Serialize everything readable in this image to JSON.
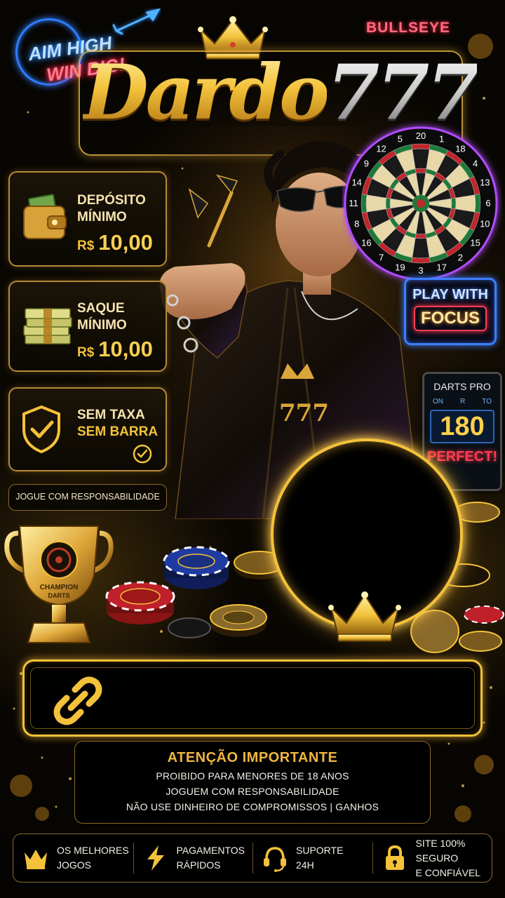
{
  "header": {
    "neon_line1": "AIM HIGH",
    "neon_line2": "WIN BIG!",
    "bullseye_label": "BULLSEYE",
    "logo_word": "Dardo",
    "logo_number": "777"
  },
  "cards": {
    "deposit": {
      "label_line1": "DEPÓSITO",
      "label_line2": "MÍNIMO",
      "currency": "R$",
      "amount": "10,00",
      "icon": "wallet-icon"
    },
    "withdraw": {
      "label_line1": "SAQUE",
      "label_line2": "MÍNIMO",
      "currency": "R$",
      "amount": "10,00",
      "icon": "cash-stack-icon"
    },
    "fee": {
      "label_line1": "SEM TAXA",
      "label_line2": "SEM BARRA",
      "icon": "shield-check-icon"
    }
  },
  "responsible_pill": "JOGUE COM RESPONSABILIDADE",
  "dartboard": {
    "numbers": [
      "20",
      "1",
      "18",
      "4",
      "13",
      "6",
      "10",
      "15",
      "2",
      "17",
      "3",
      "19",
      "7",
      "16",
      "8",
      "11",
      "14",
      "9",
      "12",
      "5"
    ]
  },
  "play_focus": {
    "line1": "PLAY WITH",
    "line2": "FOCUS"
  },
  "darts_pro": {
    "title": "DARTS PRO",
    "modes": [
      "ON",
      "R",
      "TO"
    ],
    "score": "180",
    "status": "PERFECT!"
  },
  "trophy": {
    "line1": "CHAMPION",
    "line2": "DARTS"
  },
  "link_bar": {
    "icon": "link-icon"
  },
  "warning": {
    "title": "ATENÇÃO IMPORTANTE",
    "lines": [
      "PROIBIDO PARA MENORES DE 18 ANOS",
      "JOGUEM COM RESPONSABILIDADE",
      "NÃO USE DINHEIRO DE COMPROMISSOS | GANHOS"
    ]
  },
  "features": [
    {
      "icon": "crown-icon",
      "line1": "OS MELHORES",
      "line2": "JOGOS"
    },
    {
      "icon": "lightning-icon",
      "line1": "PAGAMENTOS",
      "line2": "RÁPIDOS"
    },
    {
      "icon": "headset-icon",
      "line1": "SUPORTE",
      "line2": "24H"
    },
    {
      "icon": "lock-icon",
      "line1": "SITE 100% SEGURO",
      "line2": "E CONFIÁVEL"
    }
  ],
  "colors": {
    "gold": "#f3c23a",
    "neon_blue": "#2f7dff",
    "neon_red": "#ff2a4a",
    "background": "#000000"
  }
}
